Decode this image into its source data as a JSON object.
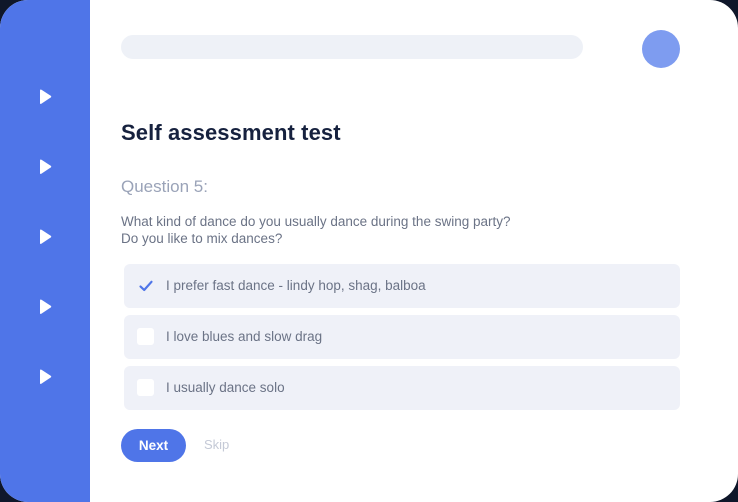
{
  "app": {
    "accent_color": "#4f75e8",
    "avatar_color": "#7e9cf0"
  },
  "sidebar": {
    "items": [
      {
        "icon": "play-icon"
      },
      {
        "icon": "play-icon"
      },
      {
        "icon": "play-icon"
      },
      {
        "icon": "play-icon"
      },
      {
        "icon": "play-icon"
      }
    ]
  },
  "header": {
    "search_placeholder": "",
    "avatar": "avatar"
  },
  "main": {
    "title": "Self assessment test",
    "question_number": "Question 5:",
    "question_text": "What kind of dance do you usually dance during the swing party? Do you like to mix dances?",
    "options": [
      {
        "label": "I prefer fast dance - lindy hop, shag, balboa",
        "checked": true
      },
      {
        "label": "I love blues and slow drag",
        "checked": false
      },
      {
        "label": "I usually dance solo",
        "checked": false
      }
    ],
    "next_label": "Next",
    "skip_label": "Skip"
  }
}
